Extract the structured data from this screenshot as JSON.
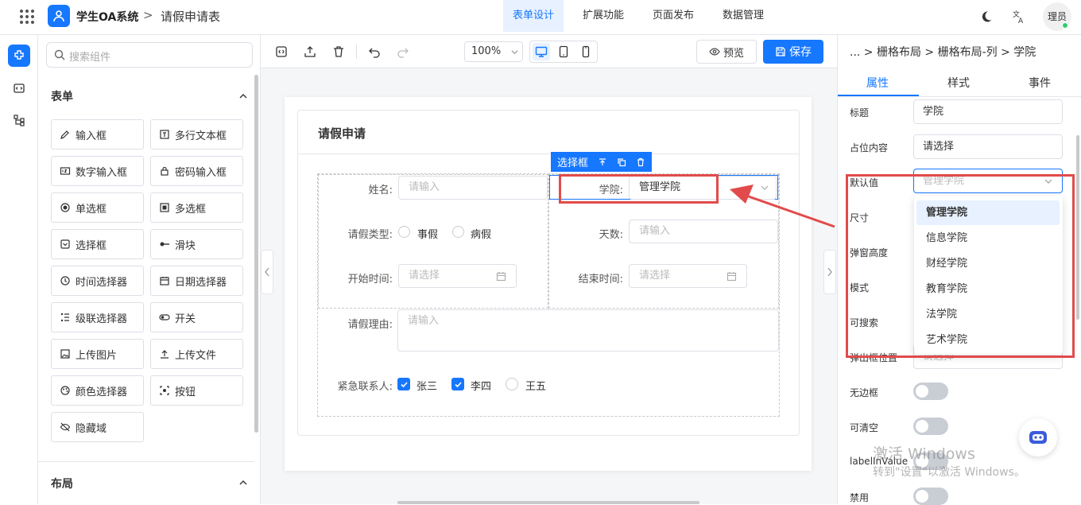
{
  "topbar": {
    "brand": "学生OA系统",
    "separator": ">",
    "page": "请假申请表",
    "nav": [
      "表单设计",
      "扩展功能",
      "页面发布",
      "数据管理"
    ],
    "active_nav": "表单设计",
    "user": "理员"
  },
  "components": {
    "search_placeholder": "搜索组件",
    "form_section": "表单",
    "items": [
      "输入框",
      "多行文本框",
      "数字输入框",
      "密码输入框",
      "单选框",
      "多选框",
      "选择框",
      "滑块",
      "时间选择器",
      "日期选择器",
      "级联选择器",
      "开关",
      "上传图片",
      "上传文件",
      "颜色选择器",
      "按钮",
      "隐藏域"
    ],
    "layout_section": "布局"
  },
  "toolbar": {
    "zoom": "100%",
    "preview": "预览",
    "save": "保存"
  },
  "form": {
    "title": "请假申请",
    "name_label": "姓名:",
    "name_placeholder": "请输入",
    "college_label": "学院:",
    "college_value": "管理学院",
    "leave_type_label": "请假类型:",
    "leave_options": [
      "事假",
      "病假"
    ],
    "days_label": "天数:",
    "days_placeholder": "请输入",
    "start_label": "开始时间:",
    "start_placeholder": "请选择",
    "end_label": "结束时间:",
    "end_placeholder": "请选择",
    "reason_label": "请假理由:",
    "reason_placeholder": "请输入",
    "contact_label": "紧急联系人:",
    "contacts": [
      {
        "name": "张三",
        "checked": true
      },
      {
        "name": "李四",
        "checked": true
      },
      {
        "name": "王五",
        "checked": false
      }
    ],
    "selected_tag": "选择框"
  },
  "props": {
    "breadcrumb": "... > 栅格布局 > 栅格布局-列 > 学院",
    "tabs": [
      "属性",
      "样式",
      "事件"
    ],
    "active_tab": "属性",
    "title_label": "标题",
    "title_value": "学院",
    "placeholder_label": "占位内容",
    "placeholder_value": "请选择",
    "default_label": "默认值",
    "default_value": "管理学院",
    "size_label": "尺寸",
    "popup_height_label": "弹窗高度",
    "mode_label": "模式",
    "searchable_label": "可搜索",
    "popup_pos_label": "弹出框位置",
    "popup_pos_placeholder": "请选择",
    "borderless_label": "无边框",
    "clearable_label": "可清空",
    "label_in_value_label": "labelInValue",
    "disabled_label": "禁用",
    "options": [
      "管理学院",
      "信息学院",
      "财经学院",
      "教育学院",
      "法学院",
      "艺术学院"
    ],
    "selected_option": "管理学院"
  },
  "watermark": {
    "line1": "激活 Windows",
    "line2": "转到\"设置\"以激活 Windows。"
  },
  "colors": {
    "primary": "#1677ff",
    "highlight": "#e24b4b"
  }
}
